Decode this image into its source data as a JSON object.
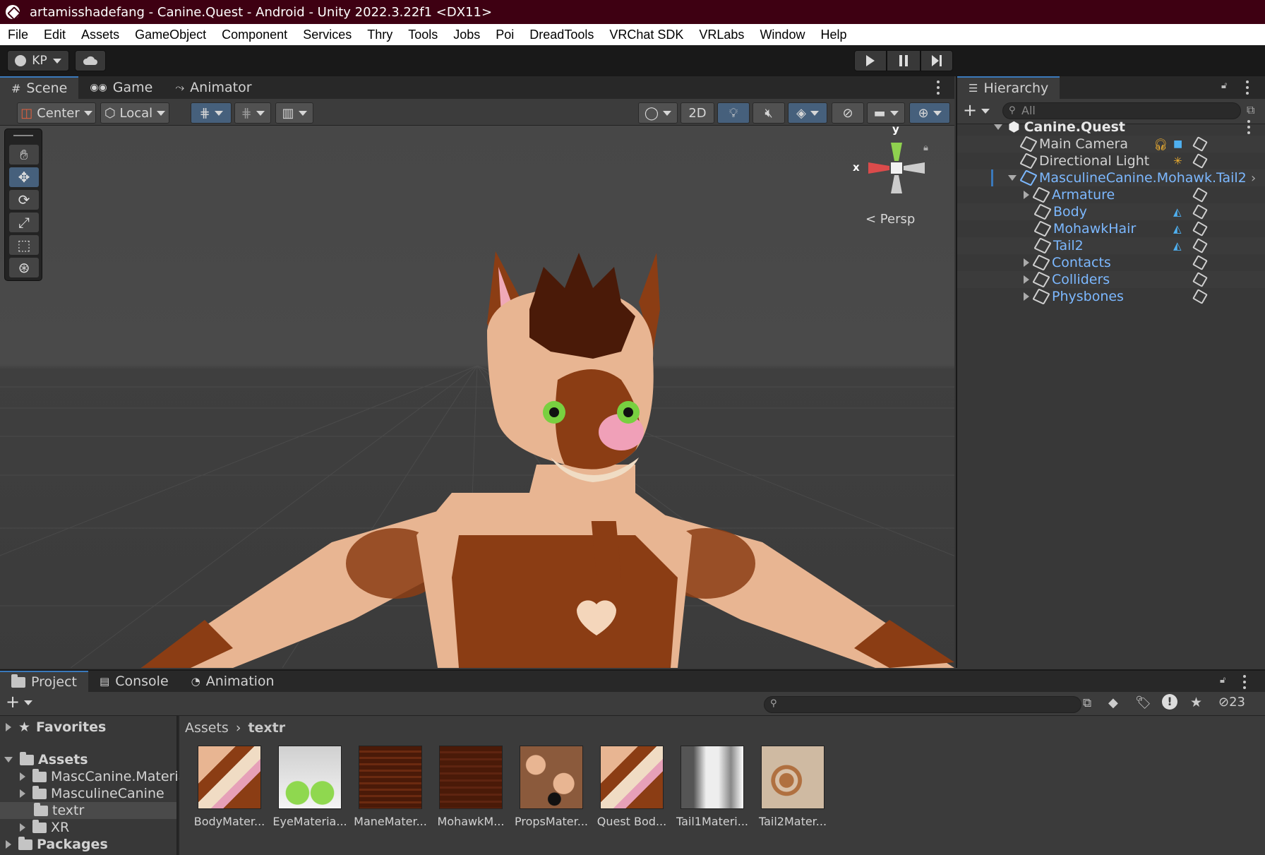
{
  "window": {
    "title": "artamisshadefang - Canine.Quest - Android - Unity 2022.3.22f1 <DX11>"
  },
  "menu": [
    "File",
    "Edit",
    "Assets",
    "GameObject",
    "Component",
    "Services",
    "Thry",
    "Tools",
    "Jobs",
    "Poi",
    "DreadTools",
    "VRChat SDK",
    "VRLabs",
    "Window",
    "Help"
  ],
  "toolbar": {
    "account": "KP"
  },
  "scene_tabs": [
    "Scene",
    "Game",
    "Animator"
  ],
  "scene_toolbar": {
    "pivot": "Center",
    "space": "Local",
    "mode_2d": "2D"
  },
  "gizmo": {
    "y_axis": "y",
    "x_axis": "x",
    "projection": "< Persp"
  },
  "hierarchy": {
    "title": "Hierarchy",
    "search_placeholder": "All",
    "scene": "Canine.Quest",
    "items": [
      "Main Camera",
      "Directional Light",
      "MasculineCanine.Mohawk.Tail2",
      "Armature",
      "Body",
      "MohawkHair",
      "Tail2",
      "Contacts",
      "Colliders",
      "Physbones"
    ]
  },
  "bottom_tabs": [
    "Project",
    "Console",
    "Animation"
  ],
  "project": {
    "hidden_count": "23",
    "tree": {
      "favorites": "Favorites",
      "assets": "Assets",
      "folders": [
        "MascCanine.Materia",
        "MasculineCanine",
        "textr",
        "XR"
      ],
      "packages": "Packages"
    },
    "breadcrumb": {
      "root": "Assets",
      "current": "textr"
    },
    "assets": [
      "BodyMater...",
      "EyeMateria...",
      "ManeMater...",
      "MohawkM...",
      "PropsMater...",
      "Quest Bod...",
      "Tail1Materi...",
      "Tail2Mater..."
    ]
  },
  "colors": {
    "titlebar": "#3e0012",
    "accent": "#3a79bb",
    "prefab_text": "#7cb8ff",
    "fur_brown": "#8b3d14",
    "fur_tan": "#e8b592"
  }
}
